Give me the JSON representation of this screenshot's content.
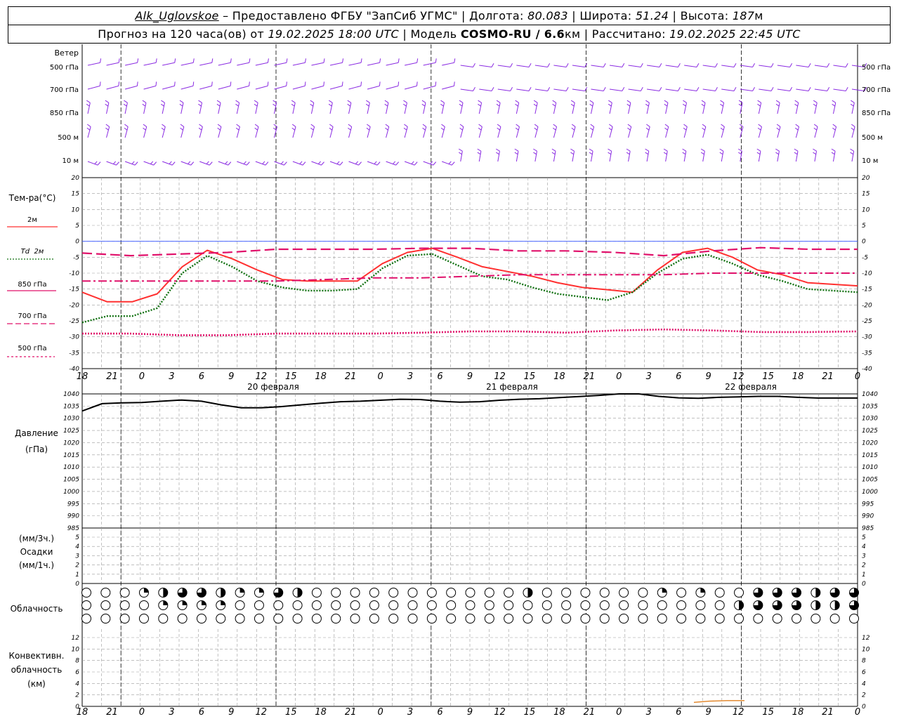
{
  "header": {
    "station": "Alk_Uglovskoe",
    "provider": " – Предоставлено ФГБУ \"ЗапСиб УГМС\" | ",
    "lon_label": "Долгота: ",
    "lon": "80.083",
    "lat_label": " | Широта: ",
    "lat": "51.24",
    "alt_label": " | Высота: ",
    "alt": "187",
    "alt_unit": "м",
    "forecast_label": "Прогноз на 120 часа(ов) от ",
    "forecast_time": "19.02.2025 18:00 UTC",
    "model_label": " | Модель ",
    "model": "COSMO-RU / 6.6",
    "model_unit": "км",
    "calc_label": " | Рассчитано: ",
    "calc_time": "19.02.2025 22:45 UTC"
  },
  "wind_panel": {
    "title": "Ветер",
    "levels": [
      "500 гПа",
      "700 гПа",
      "850 гПа",
      "500 м",
      "10 м"
    ],
    "barb_color": "#8a2be2"
  },
  "temp_panel": {
    "title": "Тем-ра(°С)",
    "legend": [
      {
        "label": "2м",
        "color": "#ff3030",
        "style": "solid"
      },
      {
        "label": "Td  2м",
        "color": "#107010",
        "style": "dotted"
      },
      {
        "label": "850 гПа",
        "color": "#e0106a",
        "style": "dashdot"
      },
      {
        "label": "700 гПа",
        "color": "#e0106a",
        "style": "dashed"
      },
      {
        "label": "500 гПа",
        "color": "#e0106a",
        "style": "dotted"
      }
    ],
    "yticks": [
      20,
      15,
      10,
      5,
      0,
      -5,
      -10,
      -15,
      -20,
      -25,
      -30,
      -35,
      -40
    ]
  },
  "pressure_panel": {
    "title1": "Давление",
    "title2": "(гПа)",
    "yticks": [
      1040,
      1035,
      1030,
      1025,
      1020,
      1015,
      1010,
      1005,
      1000,
      995,
      990,
      985
    ]
  },
  "precip_panel": {
    "title1": "(мм/3ч.)",
    "title2": "Осадки",
    "title3": "(мм/1ч.)",
    "yticks": [
      5,
      4,
      3,
      2,
      1,
      0
    ]
  },
  "cloud_panel": {
    "title": "Облачность"
  },
  "conv_panel": {
    "title1": "Конвективн.",
    "title2": "облачность",
    "title3": "(км)",
    "yticks": [
      12,
      10,
      8,
      6,
      4,
      2,
      0
    ]
  },
  "time_axis": {
    "hour_labels": [
      "18",
      "21",
      "0",
      "3",
      "6",
      "9",
      "12",
      "15",
      "18",
      "21",
      "0",
      "3",
      "6",
      "9",
      "12",
      "15",
      "18",
      "21",
      "0",
      "3",
      "6",
      "9",
      "12",
      "15",
      "18",
      "21",
      "0"
    ],
    "day_labels": [
      "20 февраля",
      "21 февраля",
      "22 февраля"
    ]
  },
  "chart_data": [
    {
      "type": "line",
      "title": "Тем-ра(°С)",
      "x_hours_from_start": [
        0,
        3,
        6,
        9,
        12,
        15,
        18,
        21,
        24,
        27,
        30,
        33,
        36,
        39,
        42,
        45,
        48,
        51,
        54,
        57,
        60,
        63,
        66,
        69,
        72,
        75,
        78,
        81,
        84,
        87,
        90,
        93,
        96,
        99,
        102,
        105,
        108,
        111,
        114,
        117,
        120
      ],
      "ylim": [
        -40,
        20
      ],
      "series": [
        {
          "name": "2м",
          "color": "#ff3030",
          "style": "solid",
          "values": [
            -16,
            -19,
            -19,
            -16.5,
            -8,
            -2.8,
            -5.5,
            -9,
            -12,
            -12.5,
            -12.5,
            -12.5,
            -7,
            -3.5,
            -2.2,
            -5,
            -8,
            -9.5,
            -11,
            -13,
            -14.5,
            -15.2,
            -16,
            -9,
            -3.5,
            -2.2,
            -5,
            -9,
            -10.5,
            -13,
            -13.5,
            -14
          ],
          "x": [
            0,
            3,
            9,
            15,
            21,
            27,
            33,
            39,
            45,
            51,
            57,
            63,
            69,
            75,
            81,
            87,
            93,
            99,
            105,
            111,
            117,
            123,
            129,
            135,
            141,
            147,
            153,
            159,
            165,
            171,
            177,
            183
          ]
        },
        {
          "name": "Td 2м",
          "color": "#107010",
          "style": "dotted",
          "values": [
            -25.5,
            -23.5,
            -23.5,
            -21,
            -10,
            -4.5,
            -8,
            -12.5,
            -14.5,
            -15.5,
            -15.5,
            -15,
            -8.5,
            -4.5,
            -4,
            -7.5,
            -11,
            -12,
            -14.5,
            -16.5,
            -17.5,
            -18.5,
            -16,
            -10,
            -5.5,
            -4.2,
            -7,
            -10.5,
            -12.5,
            -15,
            -15.5,
            -16
          ]
        },
        {
          "name": "850 гПа",
          "color": "#e0106a",
          "style": "dashdot",
          "values": [
            -12.5,
            -12.5,
            -12.5,
            -12.5,
            -12.5,
            -12,
            -11.5,
            -11.5,
            -11,
            -10.5,
            -10.5,
            -10.5,
            -10.5,
            -10,
            -10,
            -10,
            -10
          ]
        },
        {
          "name": "700 гПа",
          "color": "#e0106a",
          "style": "dashed",
          "values": [
            -3.7,
            -4.5,
            -4,
            -3.5,
            -2.5,
            -2.5,
            -2.5,
            -2.2,
            -2.2,
            -3,
            -3,
            -3.5,
            -4.5,
            -3,
            -2,
            -2.5,
            -2.5
          ]
        },
        {
          "name": "500 гПа",
          "color": "#e0106a",
          "style": "dotted",
          "values": [
            -29,
            -29,
            -29.5,
            -29.5,
            -29,
            -29,
            -29,
            -28.7,
            -28.3,
            -28.3,
            -28.7,
            -28,
            -27.7,
            -28,
            -28.5,
            -28.5,
            -28.3
          ]
        }
      ]
    },
    {
      "type": "line",
      "title": "Давление",
      "ylim": [
        985,
        1040
      ],
      "series": [
        {
          "name": "Давление",
          "color": "#000000",
          "values": [
            1033,
            1036,
            1036.3,
            1036.5,
            1037,
            1037.5,
            1037,
            1035.5,
            1034.3,
            1034.3,
            1034.8,
            1035.5,
            1036.2,
            1036.8,
            1037,
            1037.4,
            1037.8,
            1037.7,
            1037,
            1036.6,
            1036.8,
            1037.4,
            1037.8,
            1038,
            1038.5,
            1038.9,
            1039.4,
            1040,
            1040,
            1039,
            1038.4,
            1038.2,
            1038.6,
            1038.8,
            1039,
            1039,
            1038.6,
            1038.3,
            1038.3,
            1038.3
          ]
        }
      ]
    },
    {
      "type": "line",
      "title": "Конвективн. облачность",
      "ylim": [
        0,
        12
      ],
      "series": [
        {
          "name": "",
          "color": "#e08020",
          "values": [
            0.7,
            0.9,
            1.0,
            1.0
          ]
        }
      ]
    }
  ]
}
